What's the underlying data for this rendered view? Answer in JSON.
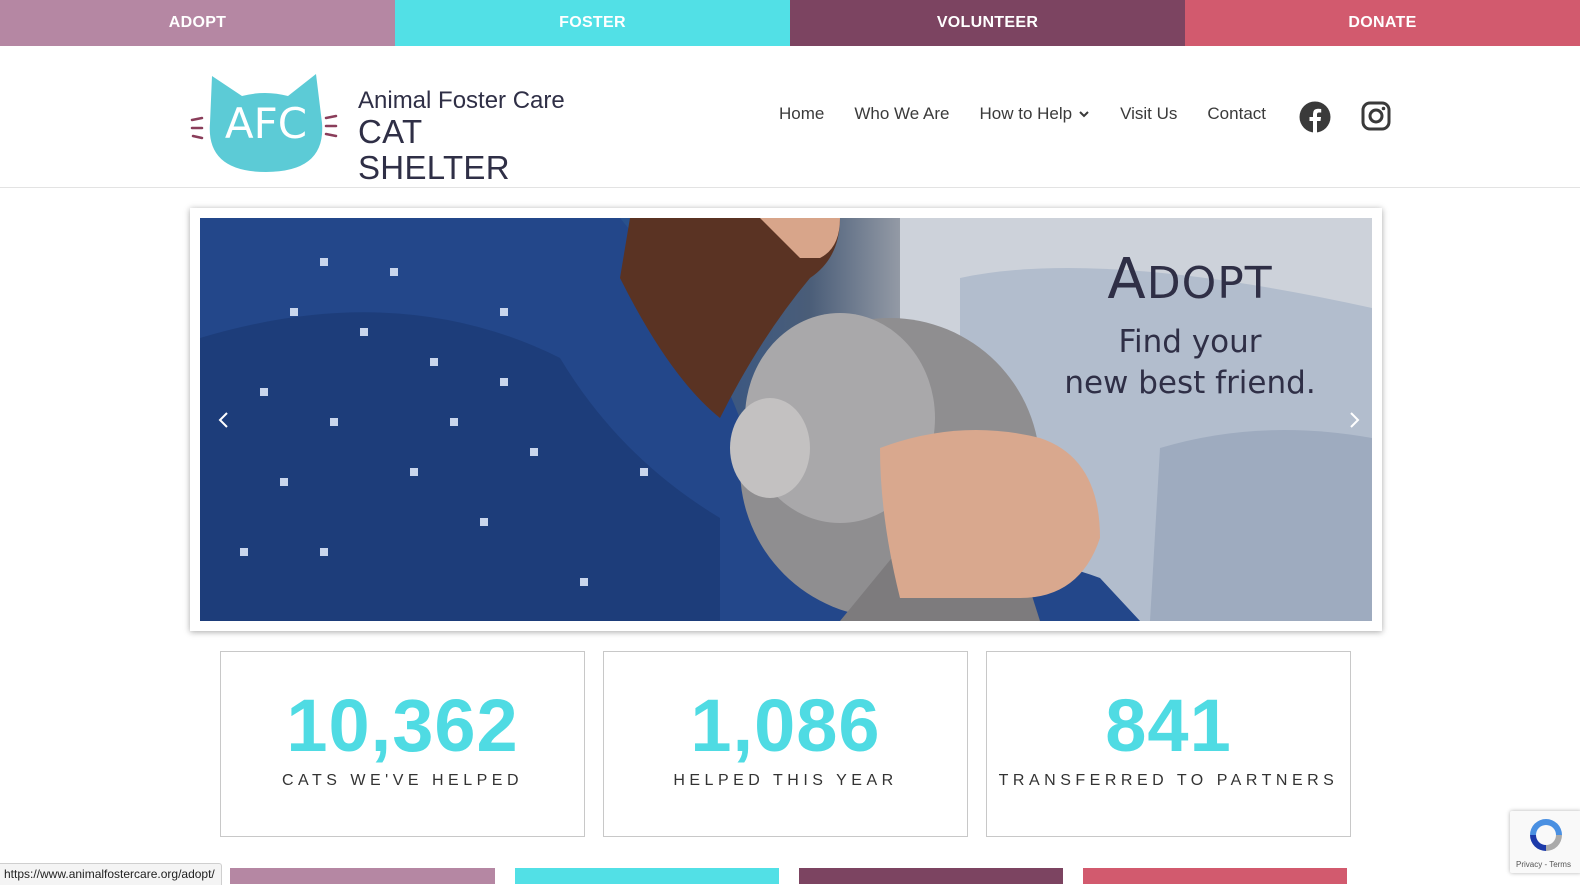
{
  "top_bar": {
    "items": [
      {
        "label": "ADOPT",
        "color": "#b587a3"
      },
      {
        "label": "FOSTER",
        "color": "#52e0e6"
      },
      {
        "label": "VOLUNTEER",
        "color": "#7c4461"
      },
      {
        "label": "DONATE",
        "color": "#d25a6e"
      }
    ]
  },
  "logo": {
    "mark_text": "AFC",
    "line1": "Animal Foster Care",
    "line2": "CAT SHELTER"
  },
  "nav": {
    "items": [
      "Home",
      "Who We Are",
      "How to Help",
      "Visit Us",
      "Contact"
    ],
    "social": [
      "facebook-icon",
      "instagram-icon"
    ]
  },
  "hero": {
    "title_first": "A",
    "title_rest": "DOPT",
    "subtitle_line1": "Find your",
    "subtitle_line2": "new best friend."
  },
  "stats": [
    {
      "value": "10,362",
      "label": "CATS WE'VE HELPED"
    },
    {
      "value": "1,086",
      "label": "HELPED THIS YEAR"
    },
    {
      "value": "841",
      "label": "TRANSFERRED TO PARTNERS"
    }
  ],
  "status_url": "https://www.animalfostercare.org/adopt/",
  "recaptcha": {
    "footer": "Privacy - Terms"
  },
  "colors": {
    "accent_teal": "#4fdbe3",
    "logo_teal": "#5ccbd6",
    "text_dark": "#2f2f46"
  }
}
